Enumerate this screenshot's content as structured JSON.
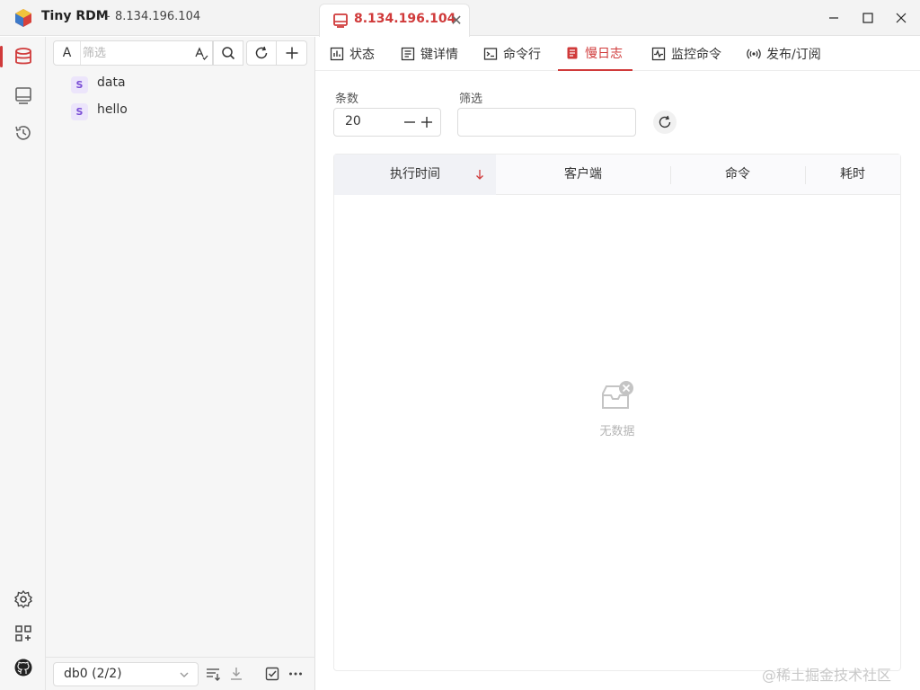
{
  "window": {
    "app_name": "Tiny RDM",
    "separator": "-",
    "host": "8.134.196.104"
  },
  "tab": {
    "label": "8.134.196.104",
    "close_glyph": "✕"
  },
  "sidebar": {
    "search_prefix": "A",
    "search_placeholder": "筛选",
    "keys": [
      {
        "type": "S",
        "name": "data"
      },
      {
        "type": "S",
        "name": "hello"
      }
    ],
    "db_select": "db0 (2/2)"
  },
  "subtabs": [
    {
      "label": "状态",
      "icon": "chart-icon"
    },
    {
      "label": "键详情",
      "icon": "detail-icon"
    },
    {
      "label": "命令行",
      "icon": "terminal-icon"
    },
    {
      "label": "慢日志",
      "icon": "log-icon",
      "active": true
    },
    {
      "label": "监控命令",
      "icon": "pulse-icon"
    },
    {
      "label": "发布/订阅",
      "icon": "broadcast-icon"
    }
  ],
  "slowlog": {
    "count_label": "条数",
    "count_value": "20",
    "filter_label": "筛选",
    "filter_value": "",
    "columns": [
      "执行时间",
      "客户端",
      "命令",
      "耗时"
    ],
    "empty_text": "无数据"
  },
  "colors": {
    "accent": "#d03a3a",
    "string_badge_bg": "#ece5fb",
    "string_badge_fg": "#7b4fd6"
  },
  "watermark": "@稀土掘金技术社区"
}
